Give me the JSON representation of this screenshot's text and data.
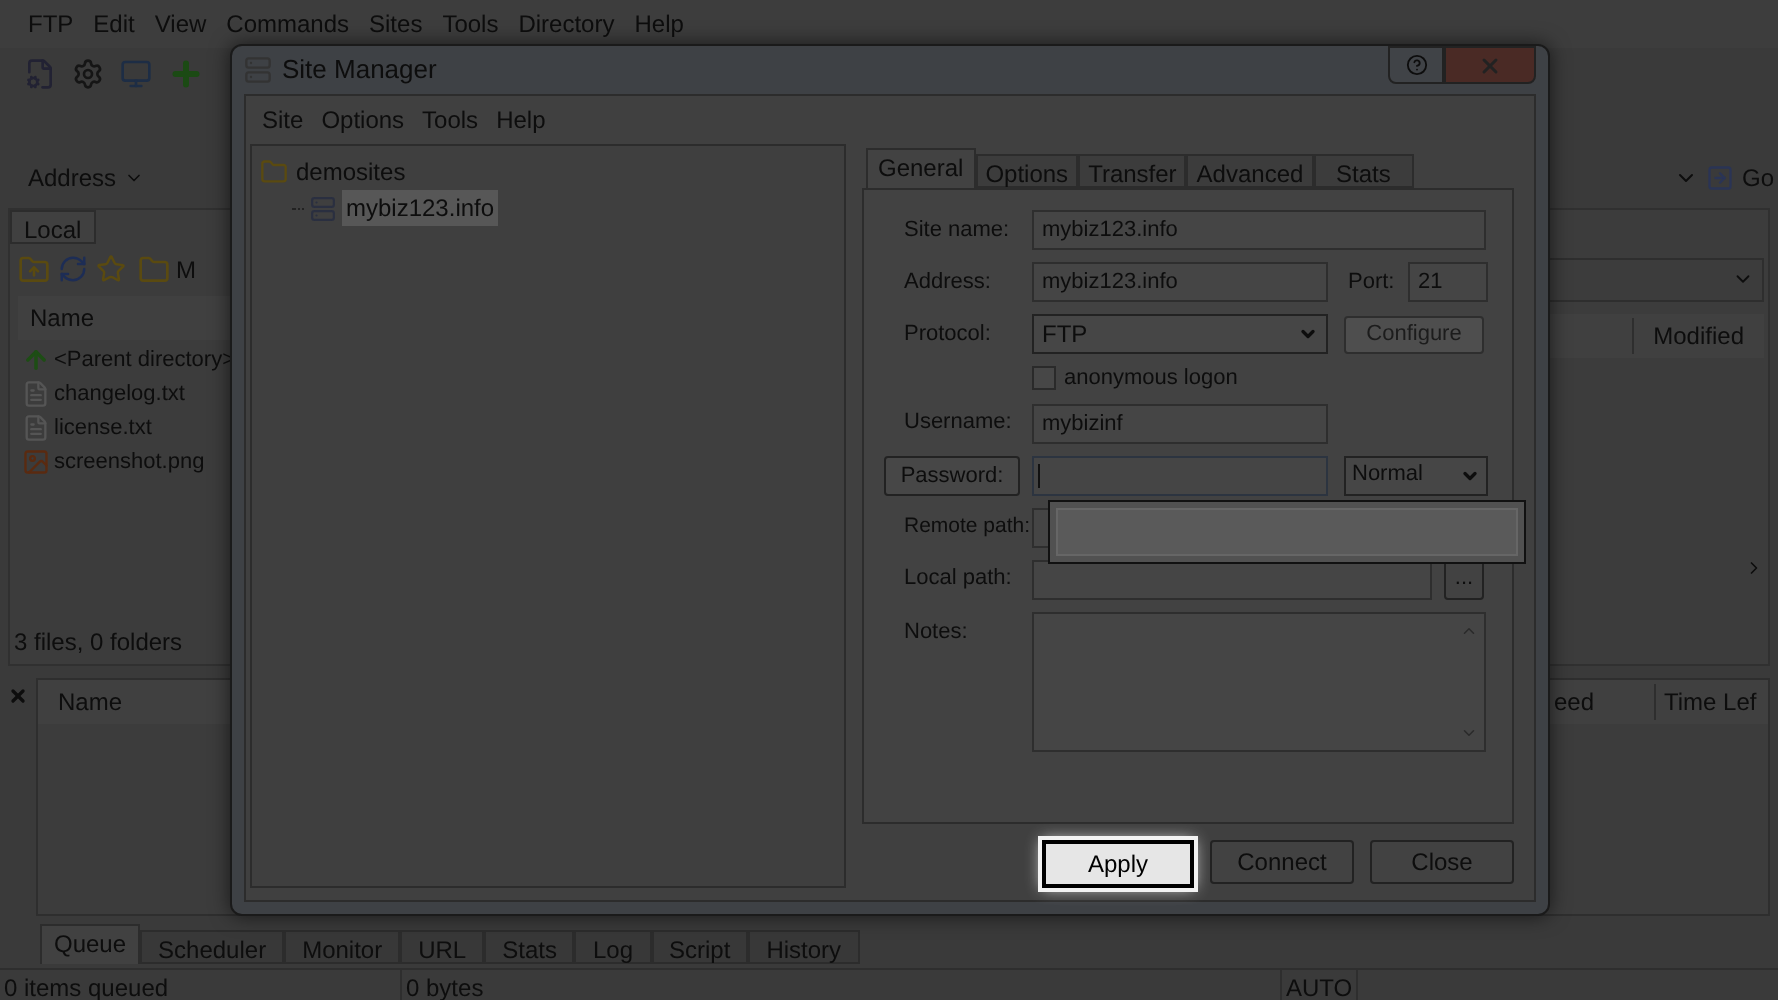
{
  "app": {
    "menu": [
      "FTP",
      "Edit",
      "View",
      "Commands",
      "Sites",
      "Tools",
      "Directory",
      "Help"
    ],
    "address_label": "Address",
    "go_label": "Go",
    "local_tab": "Local",
    "local_path": "M",
    "local_columns": [
      "Name"
    ],
    "remote_columns": [
      "Modified"
    ],
    "files": [
      {
        "name": "<Parent directory>",
        "kind": "parent"
      },
      {
        "name": "changelog.txt",
        "kind": "text"
      },
      {
        "name": "license.txt",
        "kind": "text"
      },
      {
        "name": "screenshot.png",
        "kind": "image"
      }
    ],
    "local_status": "3 files, 0 folders",
    "queue_columns": [
      "Name",
      "eed",
      "Time Lef"
    ],
    "bottom_tabs": [
      {
        "label": "Queue",
        "selected": true
      },
      {
        "label": "Scheduler",
        "selected": false
      },
      {
        "label": "Monitor",
        "selected": false
      },
      {
        "label": "URL",
        "selected": false
      },
      {
        "label": "Stats",
        "selected": false
      },
      {
        "label": "Log",
        "selected": false
      },
      {
        "label": "Script",
        "selected": false
      },
      {
        "label": "History",
        "selected": false
      }
    ],
    "status_bar": [
      "0 items queued",
      "0 bytes",
      "AUTO"
    ]
  },
  "dialog": {
    "title": "Site Manager",
    "menu": [
      "Site",
      "Options",
      "Tools",
      "Help"
    ],
    "tree": [
      {
        "label": "demosites",
        "children": [
          {
            "label": "mybiz123.info",
            "selected": true
          }
        ]
      }
    ],
    "tabs": [
      {
        "label": "General",
        "selected": true
      },
      {
        "label": "Options",
        "selected": false
      },
      {
        "label": "Transfer",
        "selected": false
      },
      {
        "label": "Advanced",
        "selected": false
      },
      {
        "label": "Stats",
        "selected": false
      }
    ],
    "site_name": {
      "label": "Site name:",
      "value": "mybiz123.info"
    },
    "address": {
      "label": "Address:",
      "value": "mybiz123.info"
    },
    "port": {
      "label": "Port:",
      "value": "21"
    },
    "protocol": {
      "label": "Protocol:",
      "value": "FTP"
    },
    "configure_button": {
      "label": "Configure",
      "disabled": true
    },
    "anonymous": {
      "label": "anonymous logon",
      "checked": false
    },
    "username": {
      "label": "Username:",
      "value": "mybizinf"
    },
    "password": {
      "button": "Password:",
      "mode": "Normal"
    },
    "remote_path": {
      "label": "Remote path:"
    },
    "local_path": {
      "label": "Local path:",
      "browse": "..."
    },
    "notes": {
      "label": "Notes:"
    },
    "buttons": [
      {
        "label": "Apply",
        "focused": true
      },
      {
        "label": "Connect",
        "focused": false
      },
      {
        "label": "Close",
        "focused": false
      }
    ]
  }
}
